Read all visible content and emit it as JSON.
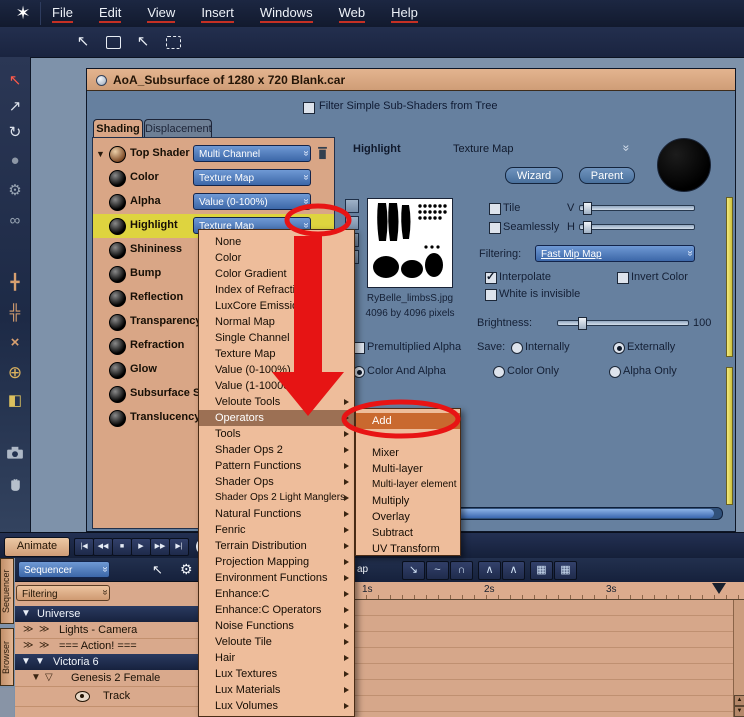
{
  "menubar": {
    "items": [
      {
        "label": "File"
      },
      {
        "label": "Edit"
      },
      {
        "label": "View"
      },
      {
        "label": "Insert"
      },
      {
        "label": "Windows"
      },
      {
        "label": "Web"
      },
      {
        "label": "Help"
      }
    ]
  },
  "icons": {
    "logo": "✶",
    "pointer": "↖",
    "lasso_pointer": "↖",
    "tri_down": "▼",
    "tri_open": "▽",
    "double_chevron": "≫",
    "header_chevron": "»",
    "gear": "⚙",
    "cursor": "↖"
  },
  "left_toolbar": {
    "tools": [
      {
        "name": "select-tool",
        "glyph": "↖"
      },
      {
        "name": "transform-tool",
        "glyph": "↗"
      },
      {
        "name": "rotate-tool",
        "glyph": "↻"
      },
      {
        "name": "scale-tool",
        "glyph": "●"
      },
      {
        "name": "wrench-tool",
        "glyph": "⚙"
      },
      {
        "name": "link-tool",
        "glyph": "∞"
      },
      {
        "name": "translate-gizmo",
        "glyph": "╋"
      },
      {
        "name": "rotate-gizmo",
        "glyph": "╬"
      },
      {
        "name": "scale-gizmo",
        "glyph": "×"
      },
      {
        "name": "sphere-map-tool",
        "glyph": "⊕"
      },
      {
        "name": "shader-swatch",
        "glyph": "◧"
      }
    ]
  },
  "window": {
    "title": "AoA_Subsurface of 1280 x 720 Blank.car",
    "filter_label": "Filter Simple Sub-Shaders from Tree",
    "tabs": [
      {
        "label": "Shading"
      },
      {
        "label": "Displacement"
      }
    ]
  },
  "shader_tree": {
    "rows": [
      {
        "label": "Top Shader",
        "value": "Multi Channel"
      },
      {
        "label": "Color",
        "value": "Texture Map"
      },
      {
        "label": "Alpha",
        "value": "Value (0-100%)"
      },
      {
        "label": "Highlight",
        "value": "Texture Map",
        "highlighted": true
      },
      {
        "label": "Shininess"
      },
      {
        "label": "Bump"
      },
      {
        "label": "Reflection"
      },
      {
        "label": "Transparency"
      },
      {
        "label": "Refraction"
      },
      {
        "label": "Glow"
      },
      {
        "label": "Subsurface Sc"
      },
      {
        "label": "Translucency"
      }
    ]
  },
  "type_menu": {
    "items": [
      {
        "label": "None"
      },
      {
        "label": "Color"
      },
      {
        "label": "Color Gradient"
      },
      {
        "label": "Index of Refraction"
      },
      {
        "label": "LuxCore Emission"
      },
      {
        "label": "Normal Map"
      },
      {
        "label": "Single Channel"
      },
      {
        "label": "Texture Map"
      },
      {
        "label": "Value (0-100%)"
      },
      {
        "label": "Value (1-10000%)"
      },
      {
        "label": "Veloute Tools"
      },
      {
        "label": "Operators",
        "highlighted": true
      },
      {
        "label": "Tools"
      },
      {
        "label": "Shader Ops 2"
      },
      {
        "label": "Pattern Functions"
      },
      {
        "label": "Shader Ops"
      },
      {
        "label": "Shader Ops 2 Light Manglers"
      },
      {
        "label": "Natural Functions"
      },
      {
        "label": "Fenric"
      },
      {
        "label": "Terrain Distribution"
      },
      {
        "label": "Projection Mapping"
      },
      {
        "label": "Environment Functions"
      },
      {
        "label": "Enhance:C"
      },
      {
        "label": "Enhance:C Operators"
      },
      {
        "label": "Noise Functions"
      },
      {
        "label": "Veloute Tile"
      },
      {
        "label": "Hair"
      },
      {
        "label": "Lux Textures"
      },
      {
        "label": "Lux Materials"
      },
      {
        "label": "Lux Volumes"
      }
    ]
  },
  "operators_submenu": {
    "items": [
      {
        "label": "Add",
        "highlighted": true
      },
      {
        "label": ""
      },
      {
        "label": "Mixer"
      },
      {
        "label": "Multi-layer"
      },
      {
        "label": "Multi-layer element"
      },
      {
        "label": "Multiply"
      },
      {
        "label": "Overlay"
      },
      {
        "label": "Subtract"
      },
      {
        "label": "UV Transform"
      }
    ]
  },
  "texture_editor": {
    "channel": "Highlight",
    "shader_type": "Texture Map",
    "wizard": "Wizard",
    "parent": "Parent",
    "filename": "RyBelle_limbsS.jpg",
    "dimensions": "4096 by 4096 pixels",
    "tile": "Tile",
    "seamlessly": "Seamlessly",
    "v": "V",
    "h": "H",
    "filtering_label": "Filtering:",
    "filtering_value": "Fast Mip Map",
    "interpolate": "Interpolate",
    "interpolate_checked": true,
    "invert_color": "Invert Color",
    "white_invisible": "White is invisible",
    "brightness_label": "Brightness:",
    "brightness_value": "100",
    "premultiplied": "Premultiplied Alpha",
    "save_label": "Save:",
    "save_internally": "Internally",
    "save_externally": "Externally",
    "save_selected": "Externally",
    "mode_color_alpha": "Color And Alpha",
    "mode_color_only": "Color Only",
    "mode_alpha_only": "Alpha Only",
    "mode_selected": "Color And Alpha"
  },
  "transport": {
    "animate": "Animate",
    "buttons": [
      {
        "glyph": "|◀"
      },
      {
        "glyph": "◀◀"
      },
      {
        "glyph": "■"
      },
      {
        "glyph": "▶"
      },
      {
        "glyph": "▶▶"
      },
      {
        "glyph": "▶|"
      }
    ]
  },
  "sequencer": {
    "tab_sequencer": "Sequencer",
    "tab_browser": "Browser",
    "dropdown": "Sequencer",
    "filtering": "Filtering",
    "tree": {
      "universe": "Universe",
      "lights": "Lights - Camera",
      "action": "=== Action! ===",
      "victoria": "Victoria 6",
      "genesis": "Genesis 2 Female",
      "track": "Track"
    }
  },
  "timeline": {
    "fragment": "ap",
    "ticks": [
      {
        "label": "1s"
      },
      {
        "label": "2s"
      },
      {
        "label": "3s"
      }
    ],
    "tool_glyphs": [
      {
        "glyph": "↘"
      },
      {
        "glyph": "~"
      },
      {
        "glyph": "∩"
      },
      {
        "glyph": "∧"
      },
      {
        "glyph": "∧"
      },
      {
        "glyph": "▦"
      },
      {
        "glyph": "▦"
      }
    ]
  },
  "colors": {
    "annotation_red": "#e81414",
    "panel_tan": "#d9a686",
    "highlight_yellow": "#ded43f",
    "dropdown_blue": "#4d79b8",
    "navy": "#17223e"
  }
}
